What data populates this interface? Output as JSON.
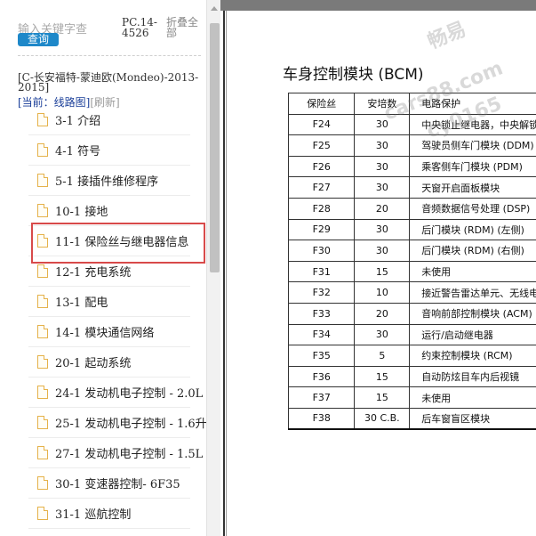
{
  "sidebar": {
    "search_placeholder": "输入关键字查",
    "search_button": "查询",
    "doc_code": "PC.14-4526",
    "collapse_all": "折叠全部",
    "model_title": "[C-长安福特-蒙迪欧(Mondeo)-2013-2015]",
    "current_label": "[当前：线路图]",
    "refresh_label": "[刷新]",
    "toc_items": [
      {
        "label": "3-1 介绍"
      },
      {
        "label": "4-1 符号"
      },
      {
        "label": "5-1 接插件维修程序"
      },
      {
        "label": "10-1 接地"
      },
      {
        "label": "11-1 保险丝与继电器信息"
      },
      {
        "label": "12-1 充电系统"
      },
      {
        "label": "13-1 配电"
      },
      {
        "label": "14-1 模块通信网络"
      },
      {
        "label": "20-1 起动系统"
      },
      {
        "label": "24-1 发动机电子控制 - 2.0L"
      },
      {
        "label": "25-1 发动机电子控制 - 1.6升"
      },
      {
        "label": "27-1 发动机电子控制 - 1.5L"
      },
      {
        "label": "30-1 变速器控制- 6F35"
      },
      {
        "label": "31-1 巡航控制"
      }
    ]
  },
  "document": {
    "section_title": "车身控制模块 (BCM)",
    "table_headers": [
      "保险丝",
      "安培数",
      "电路保护"
    ],
    "rows": [
      [
        "F24",
        "30",
        "中央锁止继电器，中央解锁"
      ],
      [
        "F25",
        "30",
        "驾驶员侧车门模块 (DDM)"
      ],
      [
        "F26",
        "30",
        "乘客侧车门模块 (PDM)"
      ],
      [
        "F27",
        "30",
        "天窗开启面板模块"
      ],
      [
        "F28",
        "20",
        "音频数据信号处理 (DSP)"
      ],
      [
        "F29",
        "30",
        "后门模块 (RDM) (左侧)"
      ],
      [
        "F30",
        "30",
        "后门模块 (RDM) (右侧)"
      ],
      [
        "F31",
        "15",
        "未使用"
      ],
      [
        "F32",
        "10",
        "接近警告雷达单元、无线电"
      ],
      [
        "F33",
        "20",
        "音响前部控制模块 (ACM)"
      ],
      [
        "F34",
        "30",
        "运行/启动继电器"
      ],
      [
        "F35",
        "5",
        "约束控制模块 (RCM)"
      ],
      [
        "F36",
        "15",
        "自动防炫目车内后视镜"
      ],
      [
        "F37",
        "15",
        "未使用"
      ],
      [
        "F38",
        "30 C.B.",
        "后车窗盲区模块"
      ]
    ],
    "watermark_lines": [
      "畅易",
      "cars88.com",
      "cy0165"
    ]
  }
}
